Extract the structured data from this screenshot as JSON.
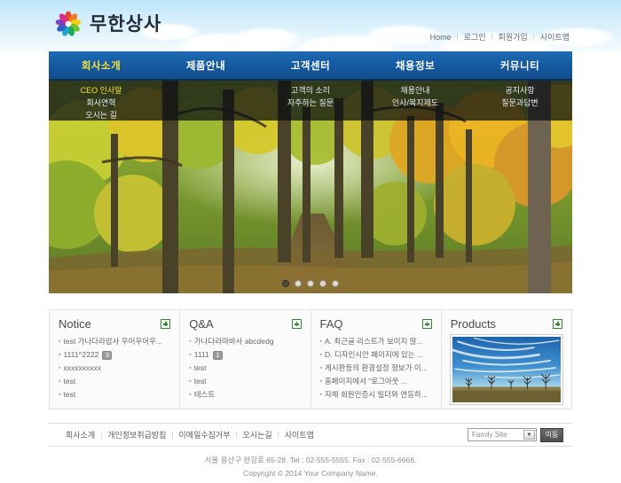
{
  "site": {
    "logo_text": "무한상사",
    "logo_icon": "rainbow-pinwheel-icon"
  },
  "top_links": [
    {
      "label": "Home"
    },
    {
      "label": "로그인"
    },
    {
      "label": "회원가입"
    },
    {
      "label": "사이트맵"
    }
  ],
  "nav": [
    {
      "label": "회사소개",
      "active": true,
      "sub": [
        {
          "label": "CEO 인사말",
          "active": true
        },
        {
          "label": "회사연혁",
          "active": false
        },
        {
          "label": "오시는 길",
          "active": false
        }
      ]
    },
    {
      "label": "제품안내",
      "active": false,
      "sub": []
    },
    {
      "label": "고객센터",
      "active": false,
      "sub": [
        {
          "label": "고객의 소리",
          "active": false
        },
        {
          "label": "자주하는 질문",
          "active": false
        }
      ]
    },
    {
      "label": "채용정보",
      "active": false,
      "sub": [
        {
          "label": "채용안내",
          "active": false
        },
        {
          "label": "인사/복지제도",
          "active": false
        }
      ]
    },
    {
      "label": "커뮤니티",
      "active": false,
      "sub": [
        {
          "label": "공지사항",
          "active": false
        },
        {
          "label": "질문과답변",
          "active": false
        }
      ]
    }
  ],
  "slider": {
    "dot_count": 5,
    "active_index": 0,
    "image_alt": "autumn-forest-path"
  },
  "boards": [
    {
      "title": "Notice",
      "more_icon": "plus-icon",
      "items": [
        {
          "text": "test 가나다라맙사 우어우어우...",
          "badge": ""
        },
        {
          "text": "1111^2222",
          "badge": "3"
        },
        {
          "text": "xxxxxxxxxx",
          "badge": ""
        },
        {
          "text": "test",
          "badge": ""
        },
        {
          "text": "test",
          "badge": ""
        }
      ]
    },
    {
      "title": "Q&A",
      "more_icon": "plus-icon",
      "items": [
        {
          "text": "가나다라마바사 abcdedg",
          "badge": ""
        },
        {
          "text": "1111",
          "badge": "1"
        },
        {
          "text": "test",
          "badge": ""
        },
        {
          "text": "test",
          "badge": ""
        },
        {
          "text": "테스트",
          "badge": ""
        }
      ]
    },
    {
      "title": "FAQ",
      "more_icon": "plus-icon",
      "items": [
        {
          "text": "A. 최근글 리스트가 보이지 않...",
          "badge": ""
        },
        {
          "text": "D. 디자인시안 페이지에 있는 ...",
          "badge": ""
        },
        {
          "text": "게시판등의 환경설정 정보가 이...",
          "badge": ""
        },
        {
          "text": "홈페이지에서 \"로그아웃 ...",
          "badge": ""
        },
        {
          "text": "자체 회원인증시 빌더와 연동하...",
          "badge": ""
        }
      ]
    },
    {
      "title": "Products",
      "more_icon": "plus-icon",
      "items": [],
      "thumb_alt": "blue-sky-trees-landscape"
    }
  ],
  "footer": {
    "links": [
      {
        "label": "회사소개"
      },
      {
        "label": "개인정보취급방침"
      },
      {
        "label": "이메일수집거부"
      },
      {
        "label": "오시는길"
      },
      {
        "label": "사이트맵"
      }
    ],
    "family_select_value": "Family Site",
    "go_button": "이동",
    "address": "서울 용산구 한강로 65-28. Tel : 02-555-5555.  Fax : 02-555-6666.",
    "copyright": "Copyright © 2014 Your Company Name."
  },
  "colors": {
    "nav_blue": "#15589f",
    "nav_active_yellow": "#f3e33c",
    "plus_green": "#2a8b2f",
    "sky_blue": "#bfe6fb"
  }
}
